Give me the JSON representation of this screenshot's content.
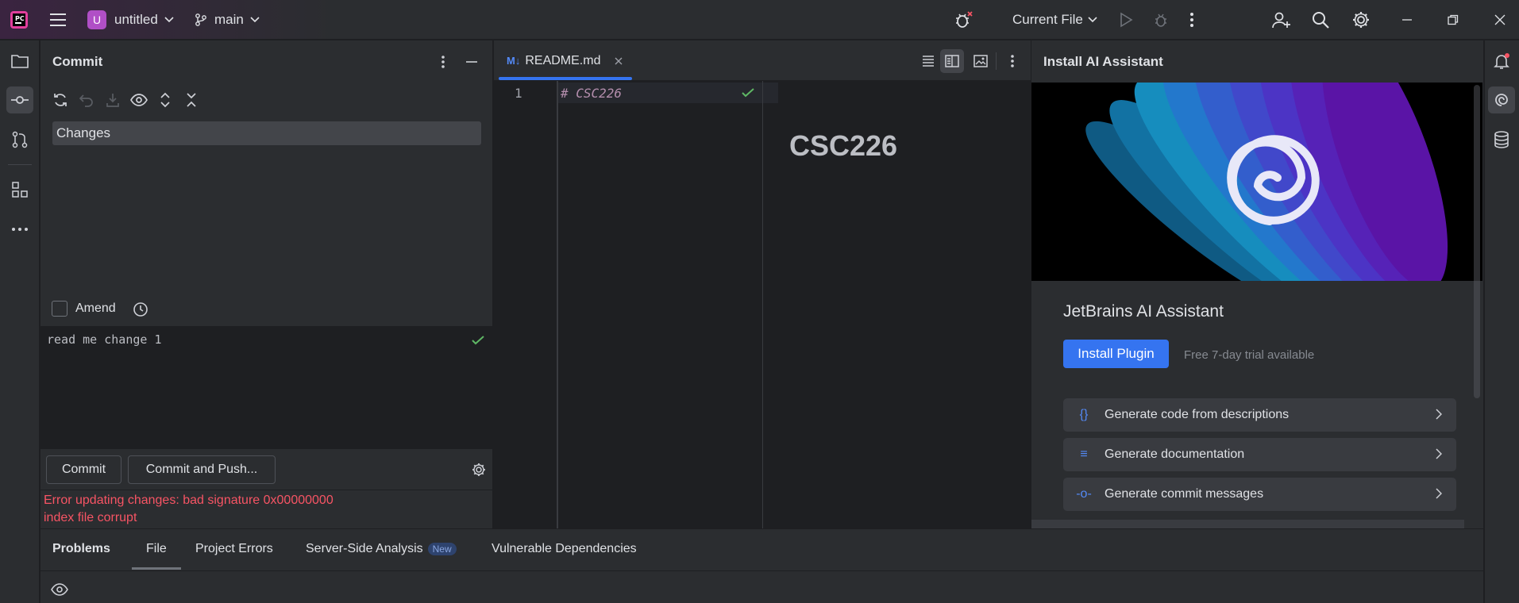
{
  "titlebar": {
    "project_initial": "U",
    "project_name": "untitled",
    "branch": "main",
    "run_config": "Current File"
  },
  "commit_panel": {
    "title": "Commit",
    "changes_label": "Changes",
    "amend_label": "Amend",
    "commit_message": "read me change 1",
    "commit_button": "Commit",
    "commit_push_button": "Commit and Push...",
    "error_line1": "Error updating changes: bad signature 0x00000000",
    "error_line2": "index file corrupt"
  },
  "editor": {
    "tab_label": "README.md",
    "tab_icon_text": "M↓",
    "line_number": "1",
    "code_line": "# CSC226",
    "preview_heading": "CSC226"
  },
  "ai_panel": {
    "title": "Install AI Assistant",
    "heading": "JetBrains AI Assistant",
    "install_button": "Install Plugin",
    "trial_text": "Free 7-day trial available",
    "features": [
      {
        "icon": "{}",
        "label": "Generate code from descriptions"
      },
      {
        "icon": "≡",
        "label": "Generate documentation"
      },
      {
        "icon": "-o-",
        "label": "Generate commit messages"
      }
    ]
  },
  "bottom_panel": {
    "tabs": [
      "Problems",
      "File",
      "Project Errors",
      "Server-Side Analysis",
      "Vulnerable Dependencies"
    ],
    "new_badge": "New"
  },
  "colors": {
    "accent": "#3574f0",
    "error": "#f75464",
    "success": "#5fb865",
    "project_badge": "#b04fc6"
  }
}
